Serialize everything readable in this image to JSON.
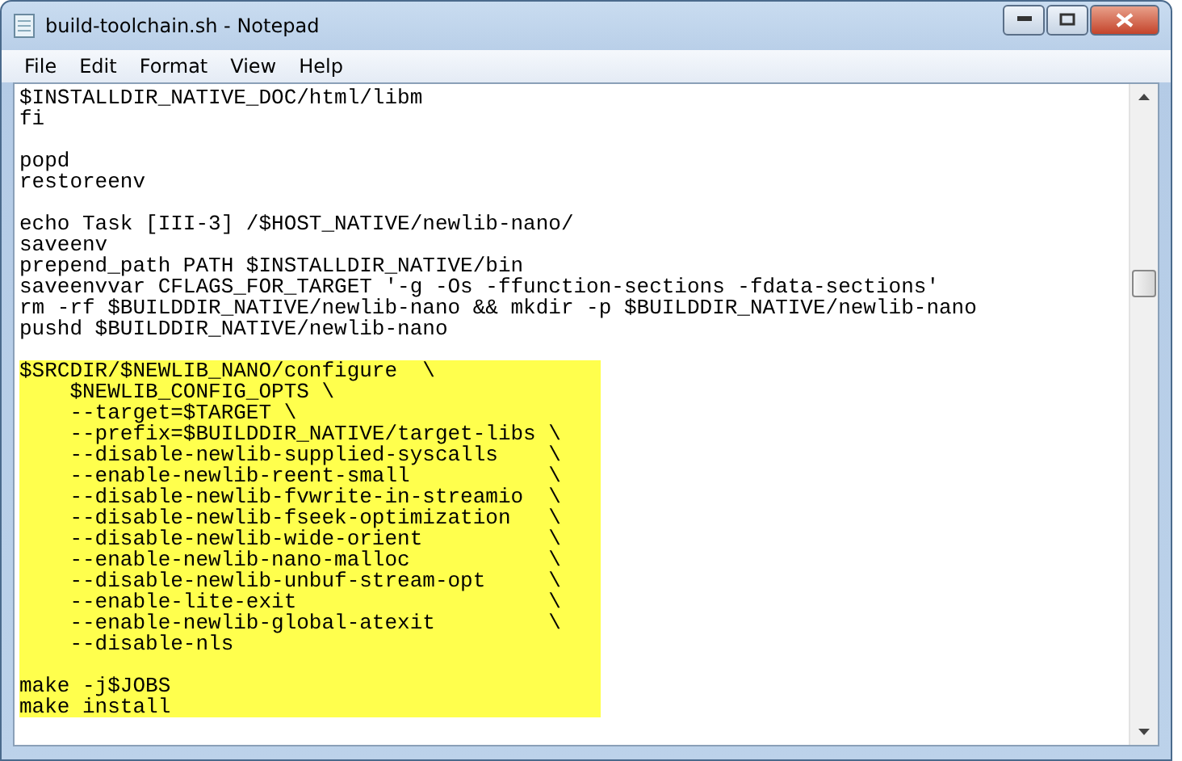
{
  "window": {
    "title": "build-toolchain.sh - Notepad"
  },
  "menu": [
    "File",
    "Edit",
    "Format",
    "View",
    "Help"
  ],
  "segments": [
    {
      "highlighted": false,
      "paragraphs": [
        [
          "$INSTALLDIR_NATIVE_DOC/html/libm",
          "fi"
        ],
        [
          "popd",
          "restoreenv"
        ],
        [
          "echo Task [III-3] /$HOST_NATIVE/newlib-nano/",
          "saveenv",
          "prepend_path PATH $INSTALLDIR_NATIVE/bin",
          "saveenvvar CFLAGS_FOR_TARGET '-g -Os -ffunction-sections -fdata-sections'",
          "rm -rf $BUILDDIR_NATIVE/newlib-nano && mkdir -p $BUILDDIR_NATIVE/newlib-nano",
          "pushd $BUILDDIR_NATIVE/newlib-nano"
        ]
      ]
    },
    {
      "highlighted": true,
      "paragraphs": [
        [
          "$SRCDIR/$NEWLIB_NANO/configure  \\",
          "    $NEWLIB_CONFIG_OPTS \\",
          "    --target=$TARGET \\",
          "    --prefix=$BUILDDIR_NATIVE/target-libs \\",
          "    --disable-newlib-supplied-syscalls    \\",
          "    --enable-newlib-reent-small           \\",
          "    --disable-newlib-fvwrite-in-streamio  \\",
          "    --disable-newlib-fseek-optimization   \\",
          "    --disable-newlib-wide-orient          \\",
          "    --enable-newlib-nano-malloc           \\",
          "    --disable-newlib-unbuf-stream-opt     \\",
          "    --enable-lite-exit                    \\",
          "    --enable-newlib-global-atexit         \\",
          "    --disable-nls"
        ],
        [
          "make -j$JOBS",
          "make install"
        ]
      ]
    }
  ]
}
